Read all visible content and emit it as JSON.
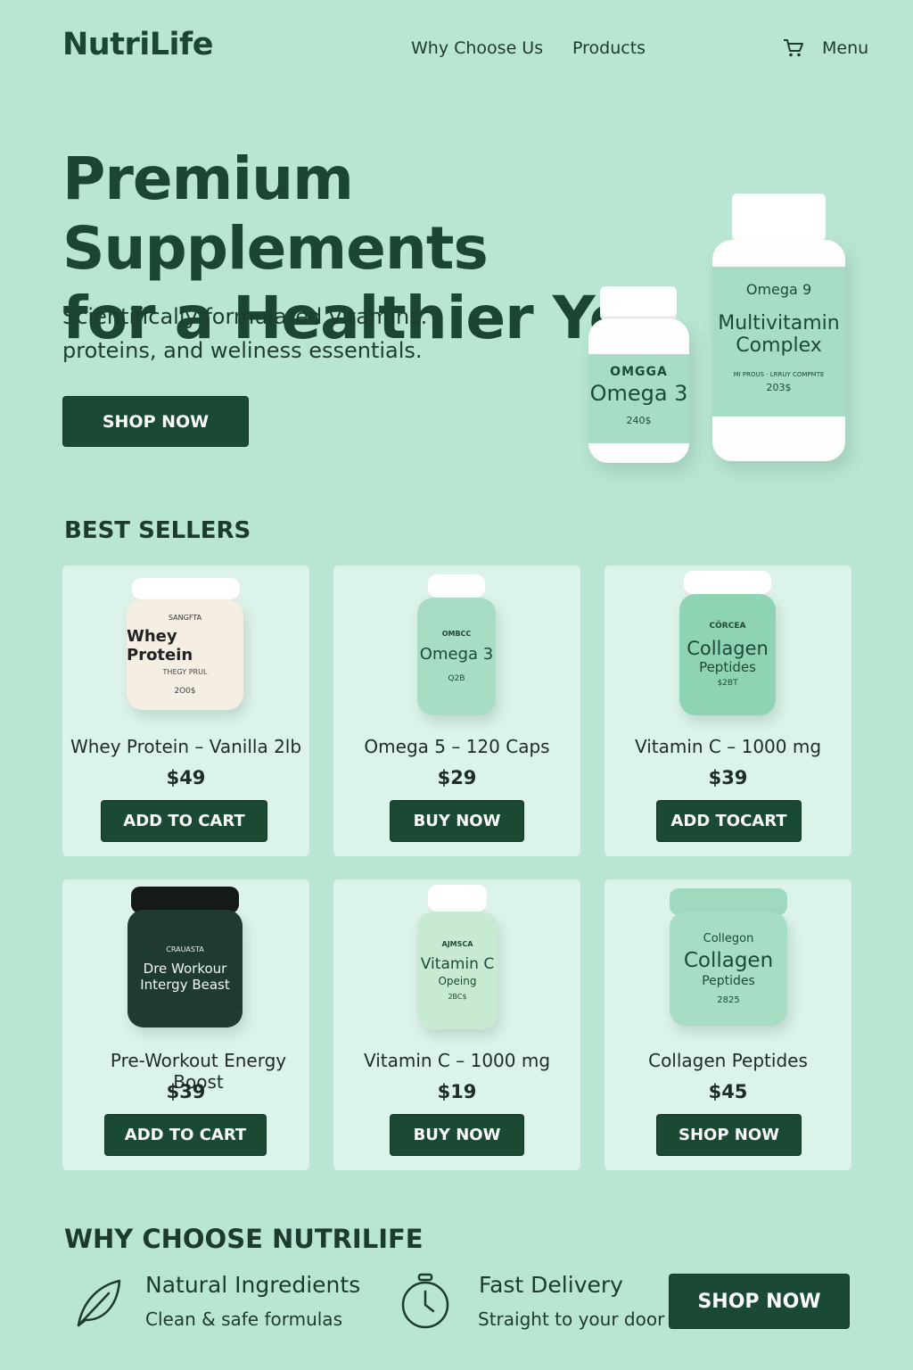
{
  "header": {
    "logo": "NutriLife",
    "nav": [
      "Why Choose Us",
      "Products"
    ],
    "menu_label": "Menu"
  },
  "hero": {
    "title_line1": "Premium Supplements",
    "title_line2": "for a Healthier You",
    "subtitle_line1": "Scientifically formulated vitamins.",
    "subtitle_line2": "proteins, and weliness essentials.",
    "cta": "SHOP NOW",
    "bottle_small": {
      "label_top": "OMGGA",
      "label_main": "Omega 3",
      "label_count": "240$"
    },
    "bottle_large": {
      "label_top": "Omega 9",
      "label_main1": "Multivitamin",
      "label_main2": "Complex",
      "label_fine": "MI PROUS · LRRUY COMPMTE",
      "label_count": "203$"
    }
  },
  "best_sellers": {
    "heading": "BEST SELLERS",
    "products": [
      {
        "name": "Whey Protein – Vanilla 2lb",
        "price": "$49",
        "button": "ADD TO CART",
        "jar_top": "SANGFTA",
        "jar_main": "Whey Protein",
        "jar_sub": "THEGY PRUL",
        "jar_count": "2O0$"
      },
      {
        "name": "Omega 5 – 120 Caps",
        "price": "$29",
        "button": "BUY NOW",
        "jar_top": "OMBCC",
        "jar_main": "Omega 3",
        "jar_sub": "",
        "jar_count": "Q2B"
      },
      {
        "name": "Vitamin C – 1000 mg",
        "price": "$39",
        "button": "ADD TOCART",
        "jar_top": "CÖRCEA",
        "jar_main": "Collagen",
        "jar_sub": "Peptides",
        "jar_count": "$2BT"
      },
      {
        "name": "Pre-Workout Energy Boost",
        "price": "$39",
        "button": "ADD TO CART",
        "jar_top": "CRAUASTA",
        "jar_main": "Dre Workour",
        "jar_sub": "Intergy Beast",
        "jar_count": ""
      },
      {
        "name": "Vitamin C – 1000 mg",
        "price": "$19",
        "button": "BUY NOW",
        "jar_top": "AJMSCA",
        "jar_main": "Vitamin C",
        "jar_sub": "Opeing",
        "jar_count": "2BC$"
      },
      {
        "name": "Collagen Peptides",
        "price": "$45",
        "button": "SHOP NOW",
        "jar_top": "Collegon",
        "jar_main": "Collagen",
        "jar_sub": "Peptides",
        "jar_count": "2825"
      }
    ]
  },
  "why": {
    "heading": "WHY CHOOSE NUTRILIFE",
    "features": [
      {
        "title": "Natural Ingredients",
        "subtitle": "Clean & safe formulas",
        "icon": "leaf-icon"
      },
      {
        "title": "Fast Delivery",
        "subtitle": "Straight to your door",
        "icon": "stopwatch-icon"
      }
    ],
    "cta": "SHOP NOW"
  },
  "colors": {
    "background": "#b9e6d2",
    "dark_green": "#1a4a33",
    "card": "#dcf3ea",
    "label_mint": "#a7dcc5"
  }
}
